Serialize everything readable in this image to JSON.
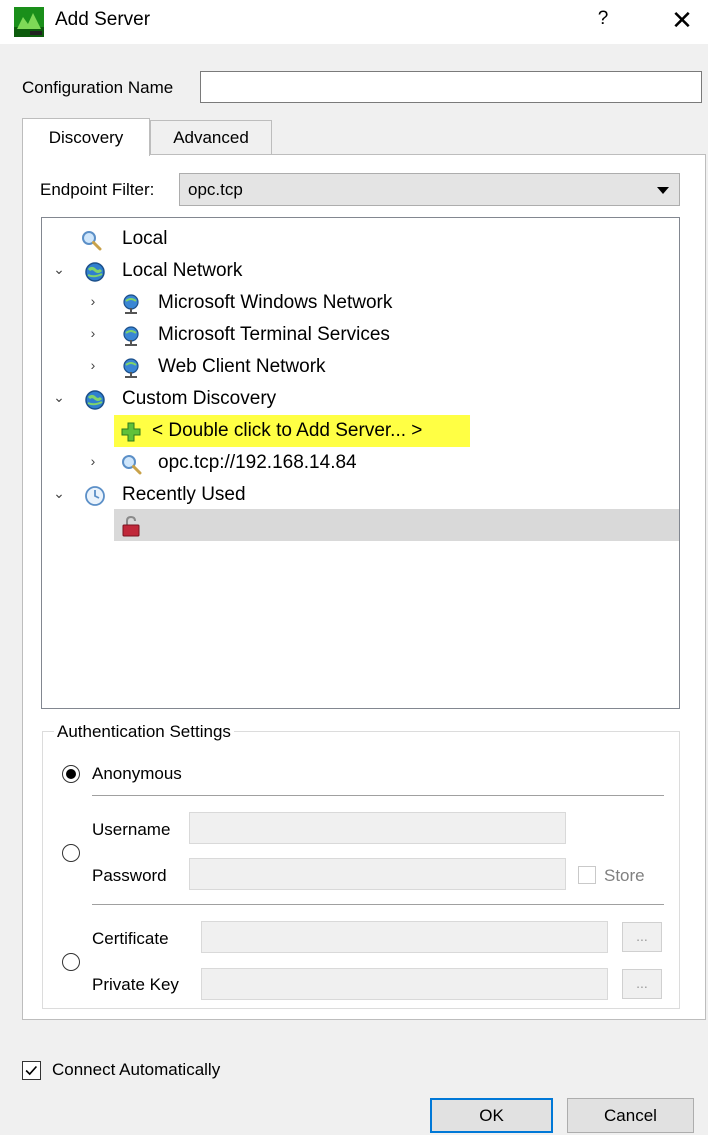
{
  "window": {
    "title": "Add Server",
    "help_label": "?",
    "close_label": "✕"
  },
  "config": {
    "label": "Configuration Name",
    "value": ""
  },
  "tabs": [
    {
      "label": "Discovery",
      "active": true
    },
    {
      "label": "Advanced",
      "active": false
    }
  ],
  "endpoint_filter": {
    "label": "Endpoint Filter:",
    "value": "opc.tcp"
  },
  "tree": {
    "items": [
      {
        "label": "Local",
        "icon": "search-icon"
      },
      {
        "label": "Local Network",
        "icon": "network-globe-icon",
        "expanded": true
      },
      {
        "label": "Microsoft Windows Network",
        "icon": "network-node-icon"
      },
      {
        "label": "Microsoft Terminal Services",
        "icon": "network-node-icon"
      },
      {
        "label": "Web Client Network",
        "icon": "network-node-icon"
      },
      {
        "label": "Custom Discovery",
        "icon": "network-globe-icon",
        "expanded": true
      },
      {
        "label": "< Double click to Add Server... >",
        "icon": "plus-icon",
        "highlighted": true
      },
      {
        "label": "opc.tcp://192.168.14.84",
        "icon": "search-icon"
      },
      {
        "label": "Recently Used",
        "icon": "clock-icon",
        "expanded": true
      },
      {
        "label": "",
        "icon": "unlocked-padlock-icon",
        "selected": true
      }
    ]
  },
  "auth": {
    "title": "Authentication Settings",
    "anonymous_label": "Anonymous",
    "username_label": "Username",
    "password_label": "Password",
    "store_label": "Store",
    "certificate_label": "Certificate",
    "private_key_label": "Private Key",
    "browse_label": "...",
    "selected": "Anonymous"
  },
  "footer": {
    "connect_label": "Connect Automatically",
    "connect_checked": true,
    "ok_label": "OK",
    "cancel_label": "Cancel"
  },
  "colors": {
    "highlight": "#ffff44",
    "selection": "#d9d9d9",
    "focus_border": "#0078d7"
  }
}
